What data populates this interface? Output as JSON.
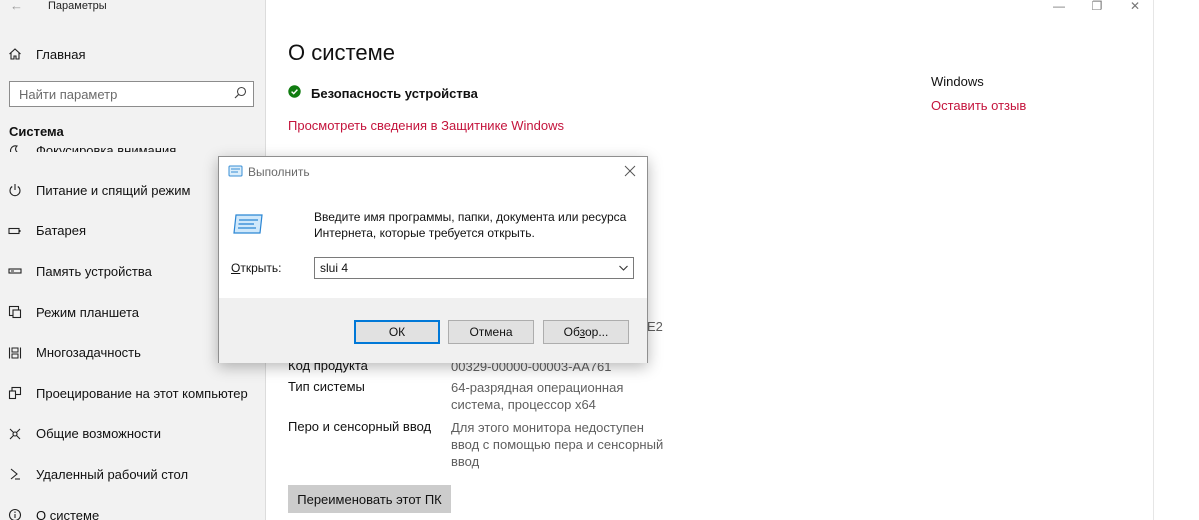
{
  "window": {
    "title": "Параметры",
    "back_glyph": "←",
    "minimize_glyph": "—",
    "maximize_glyph": "❐",
    "close_glyph": "✕"
  },
  "sidebar": {
    "home_label": "Главная",
    "search_placeholder": "Найти параметр",
    "section_title": "Система",
    "items": [
      {
        "label": "Фокусировка внимания",
        "icon": "moon-icon"
      },
      {
        "label": "Питание и спящий режим",
        "icon": "power-icon"
      },
      {
        "label": "Батарея",
        "icon": "battery-icon"
      },
      {
        "label": "Память устройства",
        "icon": "storage-icon"
      },
      {
        "label": "Режим планшета",
        "icon": "tablet-icon"
      },
      {
        "label": "Многозадачность",
        "icon": "multitask-icon"
      },
      {
        "label": "Проецирование на этот компьютер",
        "icon": "project-icon"
      },
      {
        "label": "Общие возможности",
        "icon": "shared-icon"
      },
      {
        "label": "Удаленный рабочий стол",
        "icon": "remote-icon"
      },
      {
        "label": "О системе",
        "icon": "info-icon"
      }
    ]
  },
  "main": {
    "title": "О системе",
    "security_label": "Безопасность устройства",
    "defender_link": "Просмотреть сведения в Защитнике Windows",
    "right_title": "Windows",
    "right_link": "Оставить отзыв",
    "partial_value": "E2",
    "specs": [
      {
        "key": "Код продукта",
        "value": "00329-00000-00003-AA761"
      },
      {
        "key": "Тип системы",
        "value": "64-разрядная операционная система, процессор x64"
      },
      {
        "key": "Перо и сенсорный ввод",
        "value": "Для этого монитора недоступен ввод с помощью пера и сенсорный ввод"
      }
    ],
    "rename_button": "Переименовать этот ПК"
  },
  "run_dialog": {
    "title": "Выполнить",
    "description": "Введите имя программы, папки, документа или ресурса Интернета, которые требуется открыть.",
    "open_label_underlined": "О",
    "open_label_rest": "ткрыть:",
    "input_value": "slui 4",
    "ok_button": "ОК",
    "cancel_button": "Отмена",
    "browse_button_pre": "Об",
    "browse_button_underlined": "з",
    "browse_button_post": "ор..."
  },
  "colors": {
    "accent_link": "#c4143c",
    "security_ok": "#107c10",
    "sidebar_bg": "#f2f2f2"
  }
}
